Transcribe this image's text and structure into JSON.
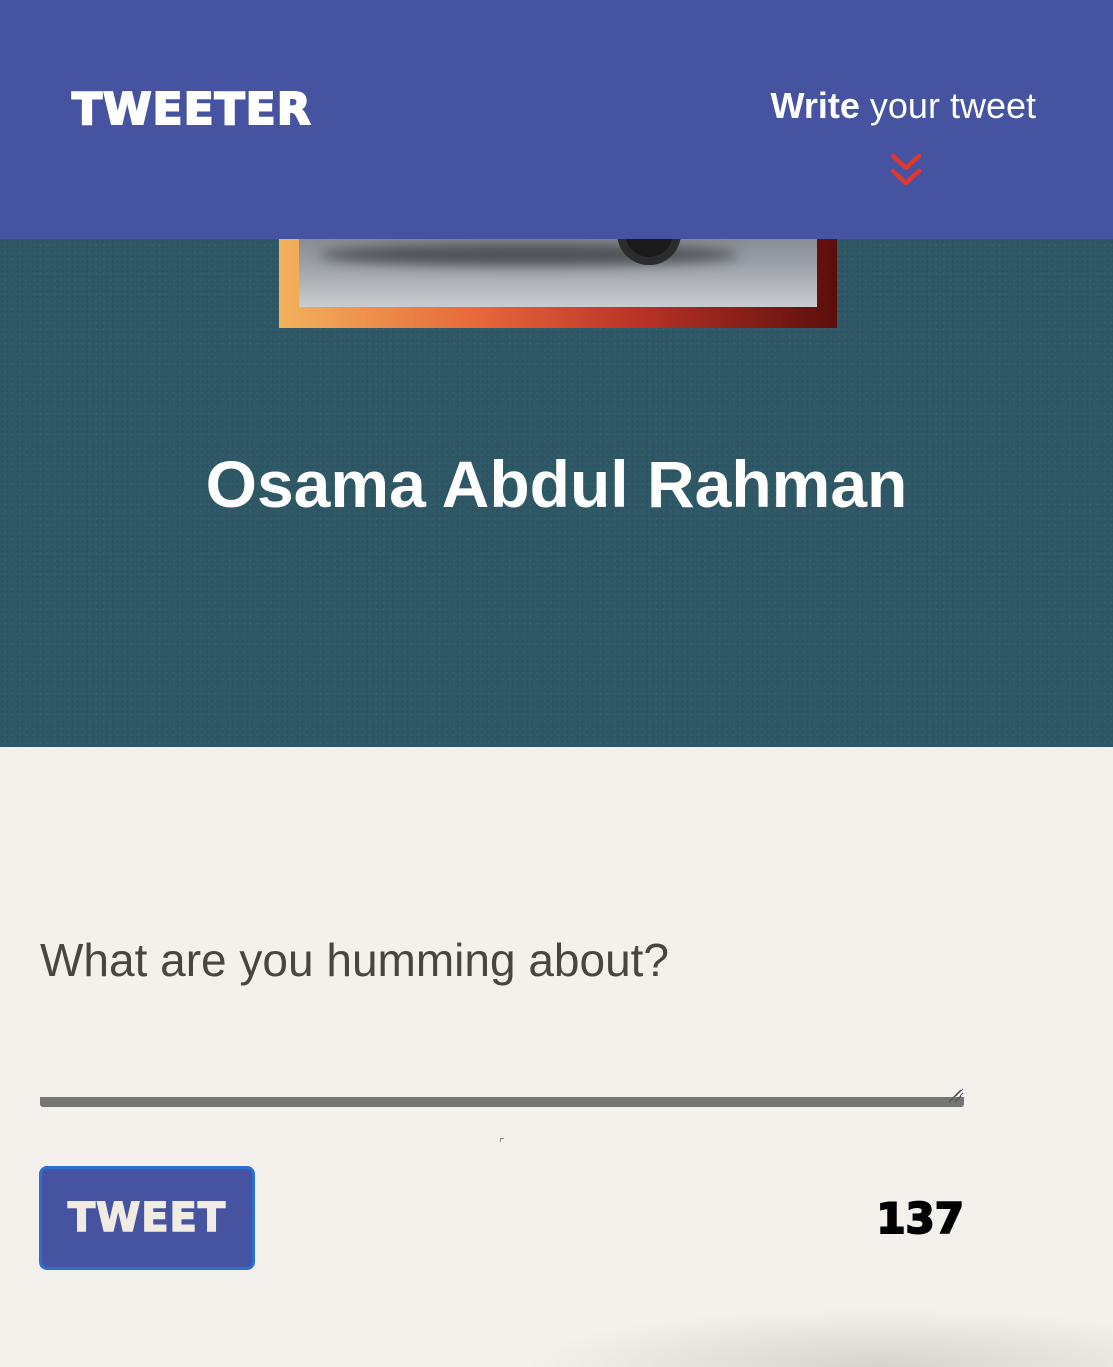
{
  "nav": {
    "brand": "TWEETER",
    "compose_link": {
      "bold": "Write",
      "rest": " your tweet"
    },
    "chevron_icon": "double-chevron-down-icon",
    "accent_color": "#e0382c"
  },
  "profile": {
    "name": "Osama Abdul Rahman",
    "avatar_icon": "profile-photo"
  },
  "compose": {
    "placeholder": "What are you humming about?",
    "value": "",
    "tweet_button_label": "TWEET",
    "counter": "137"
  },
  "colors": {
    "nav_bg": "#4553a0",
    "profile_bg": "#2f5866",
    "page_bg": "#f4f1ec",
    "button_border": "#2a6fd6"
  }
}
